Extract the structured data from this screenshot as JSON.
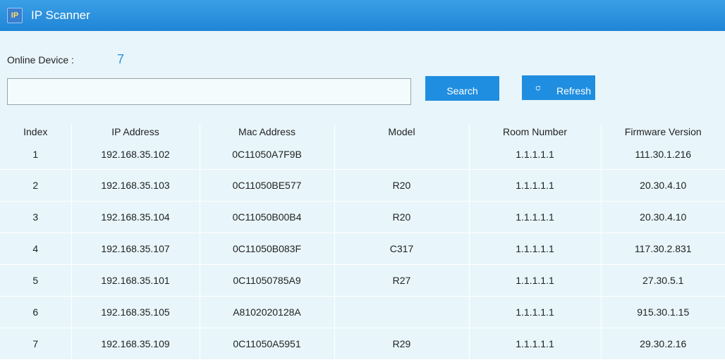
{
  "window": {
    "icon_text": "IP",
    "title": "IP Scanner"
  },
  "status": {
    "online_label": "Online Device :",
    "online_count": "7"
  },
  "search": {
    "value": "",
    "placeholder": "",
    "search_label": "Search",
    "refresh_label": "Refresh"
  },
  "icons": {
    "refresh": "refresh-icon",
    "app": "app-icon"
  },
  "colors": {
    "titlebar": "#1f85d6",
    "button": "#1f8ee0",
    "background": "#e8f6fb",
    "count": "#2a92d9"
  },
  "table": {
    "columns": [
      "Index",
      "IP Address",
      "Mac Address",
      "Model",
      "Room Number",
      "Firmware Version"
    ],
    "rows": [
      [
        "1",
        "192.168.35.102",
        "0C11050A7F9B",
        "",
        "1.1.1.1.1",
        "111.30.1.216"
      ],
      [
        "2",
        "192.168.35.103",
        "0C11050BE577",
        "R20",
        "1.1.1.1.1",
        "20.30.4.10"
      ],
      [
        "3",
        "192.168.35.104",
        "0C11050B00B4",
        "R20",
        "1.1.1.1.1",
        "20.30.4.10"
      ],
      [
        "4",
        "192.168.35.107",
        "0C11050B083F",
        "C317",
        "1.1.1.1.1",
        "117.30.2.831"
      ],
      [
        "5",
        "192.168.35.101",
        "0C11050785A9",
        "R27",
        "1.1.1.1.1",
        "27.30.5.1"
      ],
      [
        "6",
        "192.168.35.105",
        "A8102020128A",
        "",
        "1.1.1.1.1",
        "915.30.1.15"
      ],
      [
        "7",
        "192.168.35.109",
        "0C11050A5951",
        "R29",
        "1.1.1.1.1",
        "29.30.2.16"
      ]
    ]
  }
}
